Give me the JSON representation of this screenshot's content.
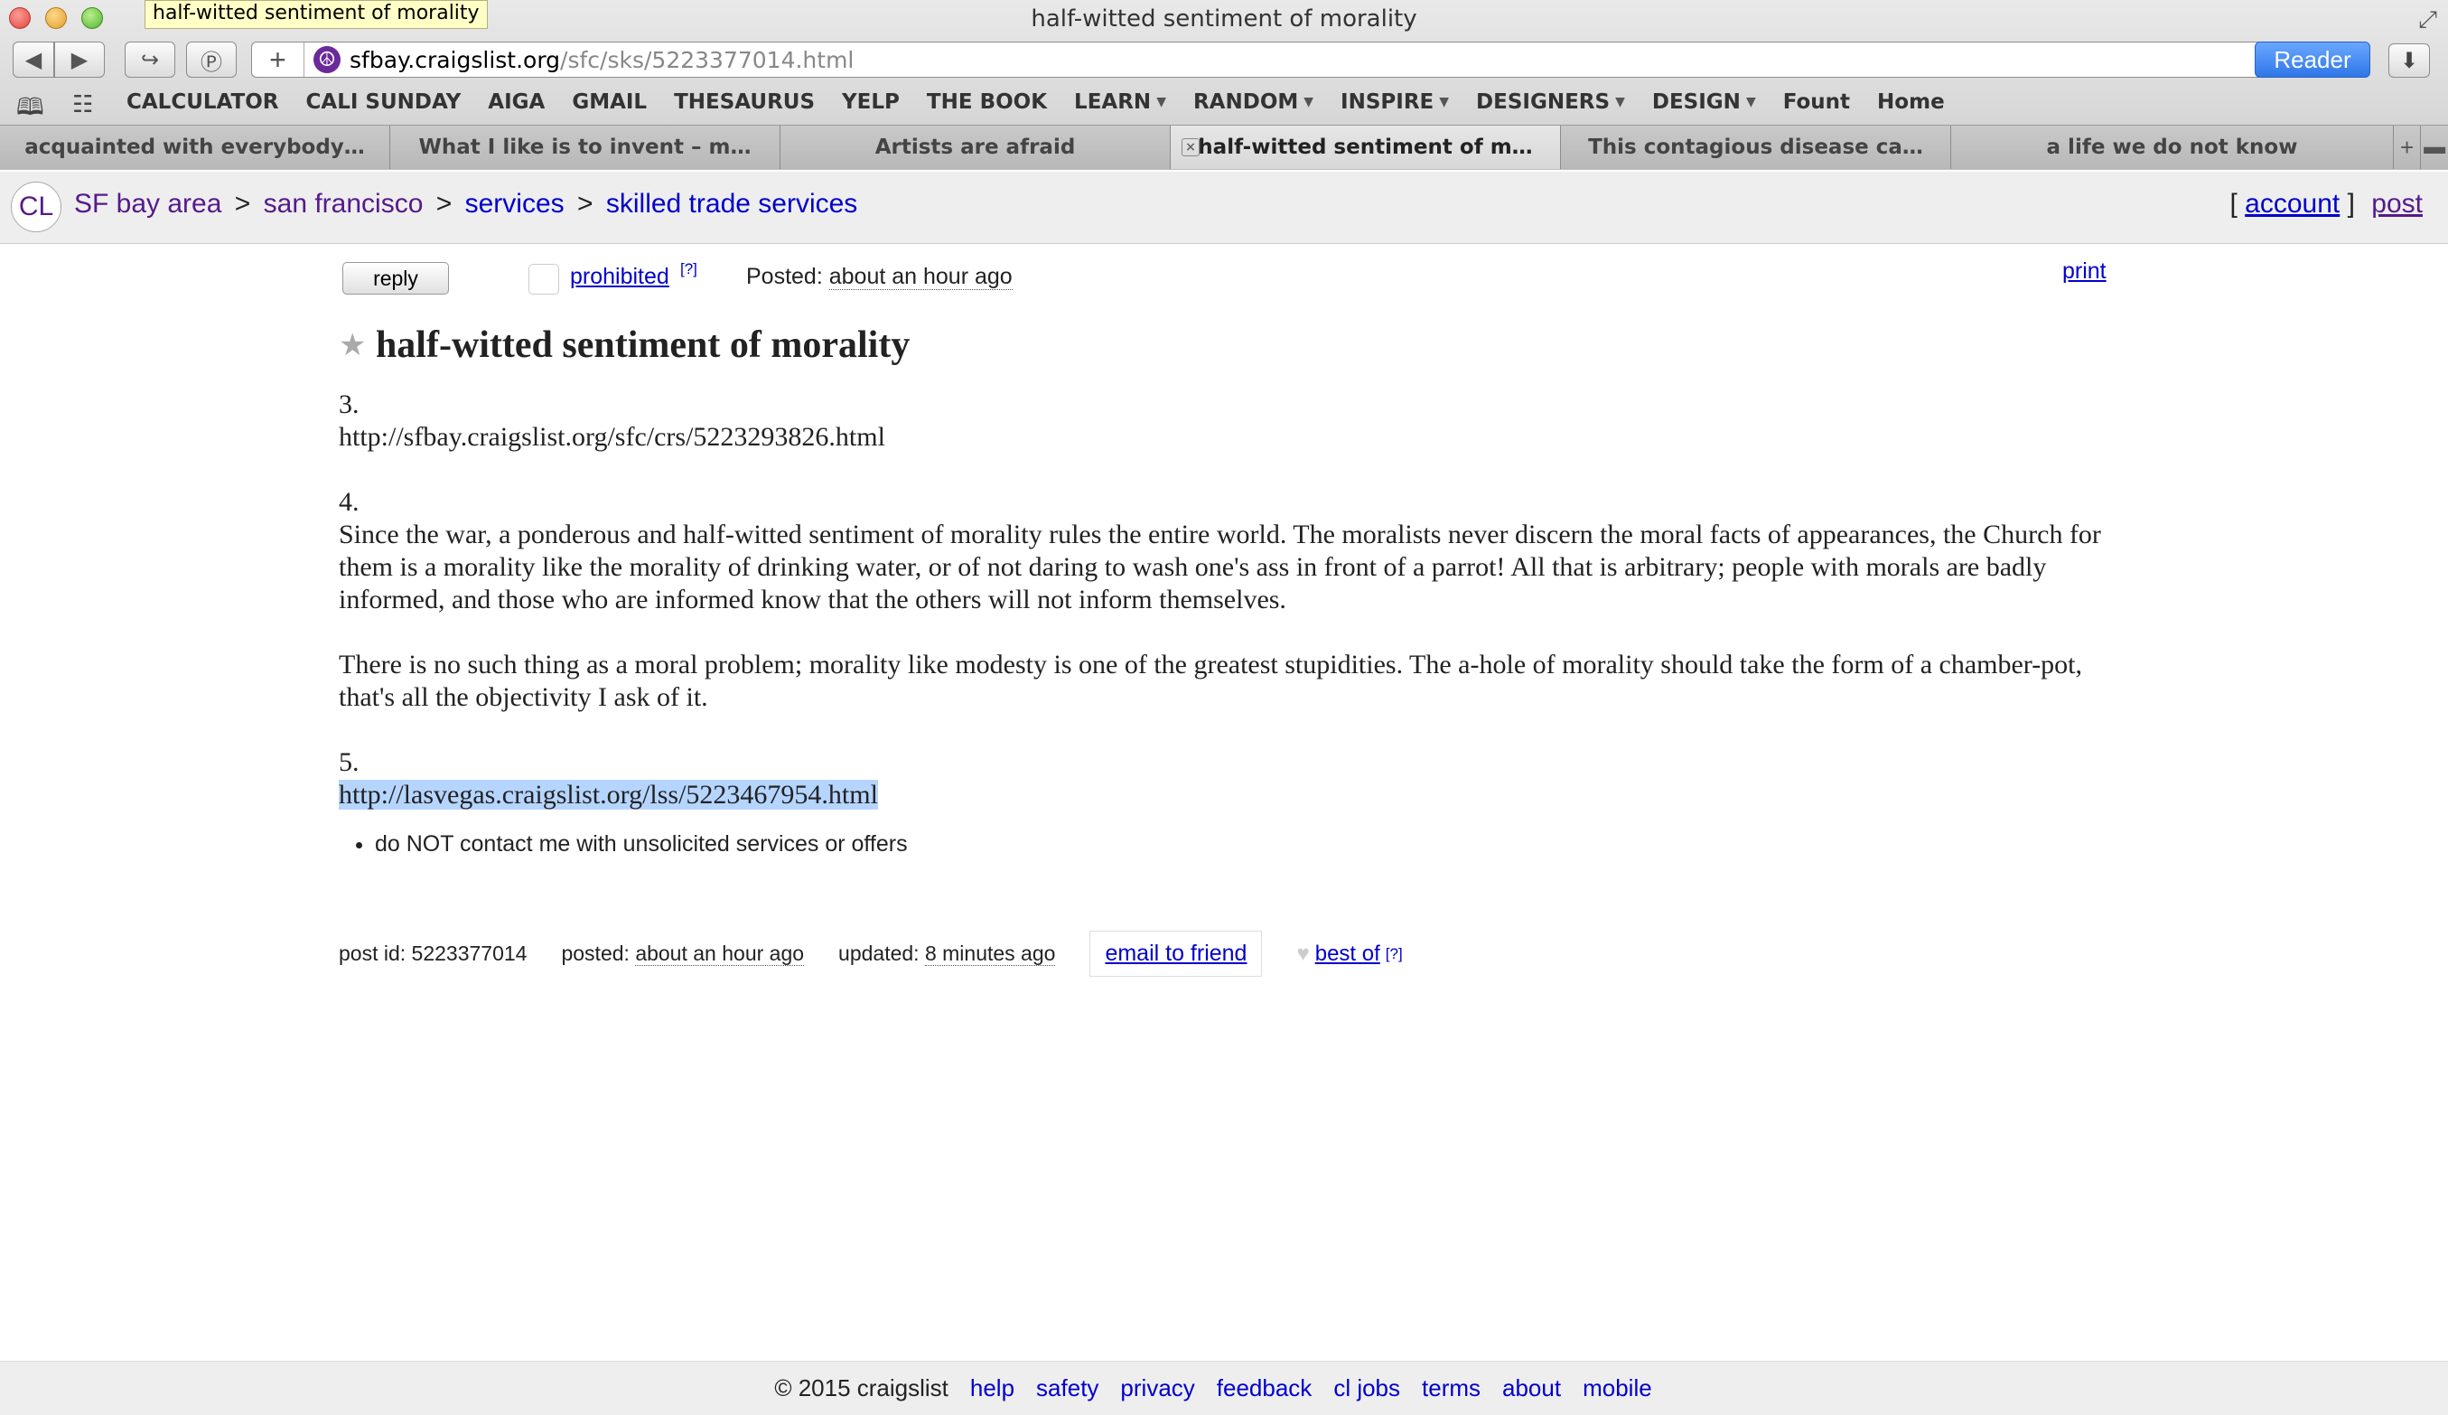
{
  "window": {
    "title": "half-witted sentiment of morality",
    "tooltip": "half-witted sentiment of morality",
    "fullscreen_icon": "expand-arrows-icon"
  },
  "toolbar": {
    "url_host": "sfbay.craigslist.org",
    "url_path": "/sfc/sks/5223377014.html",
    "reader_label": "Reader",
    "icons": {
      "back": "◀",
      "forward": "▶",
      "share": "↪",
      "pinboard": "Ⓟ",
      "add_bookmark": "+",
      "site": "☮",
      "reload": "↻",
      "download": "⬇"
    }
  },
  "bookmarks": [
    "CALCULATOR",
    "CALI SUNDAY",
    "AIGA",
    "GMAIL",
    "THESAURUS",
    "YELP",
    "THE BOOK",
    "LEARN",
    "RANDOM",
    "INSPIRE",
    "DESIGNERS",
    "DESIGN",
    "Fount",
    "Home"
  ],
  "bookmarks_with_menu": [
    "LEARN",
    "RANDOM",
    "INSPIRE",
    "DESIGNERS",
    "DESIGN"
  ],
  "tabs": [
    {
      "label": "acquainted with everybody…",
      "active": false
    },
    {
      "label": "What I like is to invent – m…",
      "active": false
    },
    {
      "label": "Artists are afraid",
      "active": false
    },
    {
      "label": "half-witted sentiment of m…",
      "active": true
    },
    {
      "label": "This contagious disease ca…",
      "active": false
    },
    {
      "label": "a life we do not know",
      "active": false
    }
  ],
  "craigslist": {
    "logo": "CL",
    "breadcrumb": [
      "SF bay area",
      "san francisco",
      "services",
      "skilled trade services"
    ],
    "breadcrumb_sep": ">",
    "account_label": "account",
    "post_label": "post",
    "bracket_open": "[",
    "bracket_close": "]"
  },
  "posting": {
    "reply_label": "reply",
    "prohibited_label": "prohibited",
    "help_mark": "[?]",
    "posted_label": "Posted:",
    "posted_value": "about an hour ago",
    "print_label": "print",
    "star_icon": "★",
    "title": "half-witted sentiment of morality",
    "body": {
      "n3": "3.",
      "url3": "http://sfbay.craigslist.org/sfc/crs/5223293826.html",
      "n4": "4.",
      "para1": "Since the war, a ponderous and half-witted sentiment of morality rules the entire world. The moralists never discern the moral facts of appearances, the Church for them is a morality like the morality of drinking water, or of not daring to wash one's ass in front of a parrot! All that is arbitrary; people with morals are badly informed, and those who are informed know that the others will not inform themselves.",
      "para2": "There is no such thing as a moral problem; morality like modesty is one of the greatest stupidities. The a-hole of morality should take the form of a chamber-pot, that's all the objectivity I ask of it.",
      "n5": "5.",
      "url5": "http://lasvegas.craigslist.org/lss/5223467954.html"
    },
    "notice": "do NOT contact me with unsolicited services or offers",
    "info": {
      "post_id_label": "post id:",
      "post_id": "5223377014",
      "posted_label": "posted:",
      "posted_value": "about an hour ago",
      "updated_label": "updated:",
      "updated_value": "8 minutes ago",
      "email_label": "email to friend",
      "heart_icon": "♥",
      "bestof_label": "best of"
    }
  },
  "footer": {
    "copyright": "© 2015 craigslist",
    "links": [
      "help",
      "safety",
      "privacy",
      "feedback",
      "cl jobs",
      "terms",
      "about",
      "mobile"
    ]
  },
  "colors": {
    "link": "#0000cc",
    "visited": "#551a8b",
    "selection": "#b5d5ff",
    "reader_button": "#2f77e8"
  }
}
